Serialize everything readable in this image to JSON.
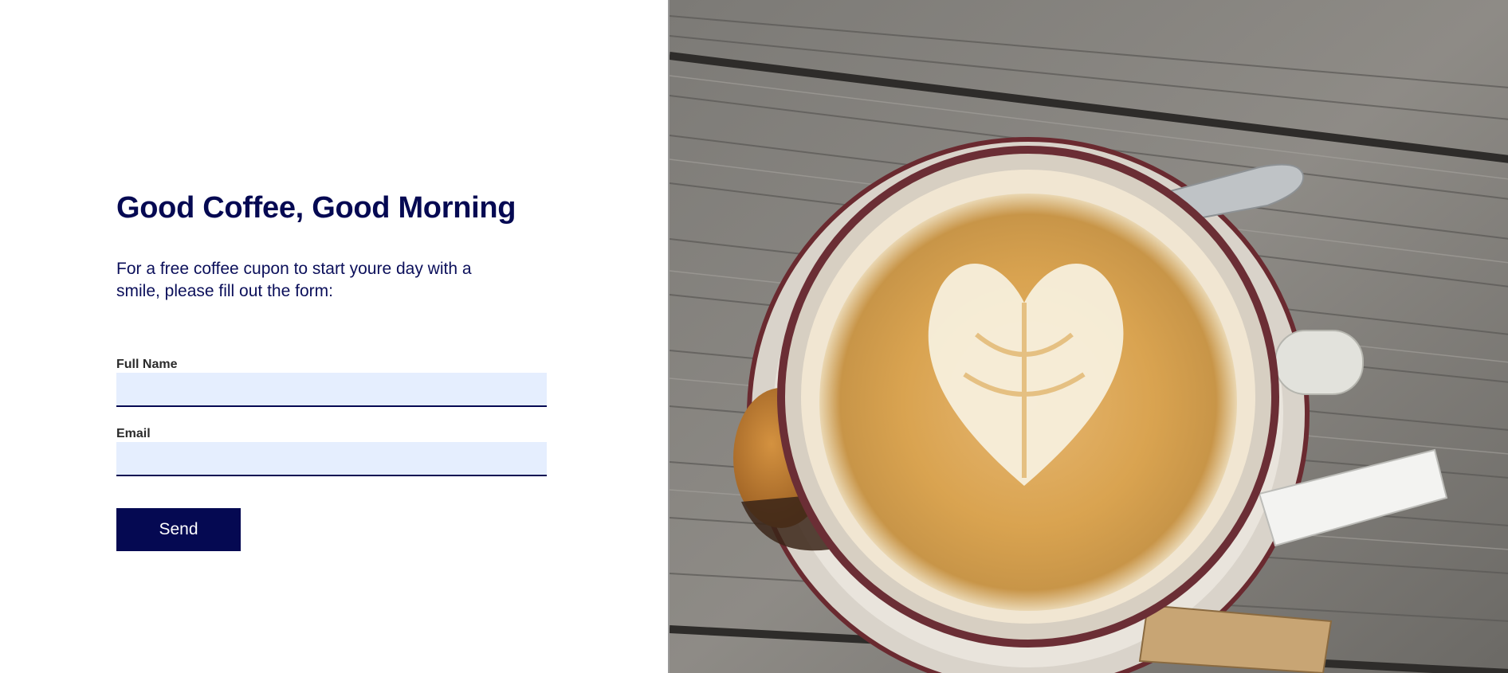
{
  "heading": "Good Coffee, Good Morning",
  "intro": "For a free coffee cupon to start youre day with a smile, please fill out the form:",
  "form": {
    "full_name_label": "Full Name",
    "full_name_value": "",
    "email_label": "Email",
    "email_value": "",
    "send_label": "Send"
  },
  "hero_image": {
    "icon": "latte-art-photo"
  },
  "colors": {
    "navy": "#050952",
    "input_bg": "#e5eefe",
    "white": "#ffffff"
  }
}
